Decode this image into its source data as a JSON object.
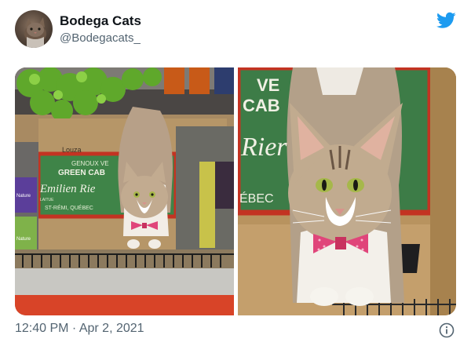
{
  "author": {
    "display_name": "Bodega Cats",
    "handle": "@Bodegacats_",
    "avatar_icon": "cat-avatar"
  },
  "brand": {
    "icon": "twitter-bird-icon",
    "color": "#1d9bf0"
  },
  "media": [
    {
      "icon": "cat-bow-tie-photo",
      "box_text": {
        "brand": "Louza",
        "line1": "GENOUX VE",
        "line2": "GREEN CAB",
        "line3": "Emilien Rie",
        "line4": "ST-RÉMI, QUÉBEC",
        "small": "LAITUE"
      },
      "packets": [
        "Nature",
        "Nature"
      ]
    },
    {
      "icon": "cat-closeup-photo",
      "box_text": {
        "line1": "VE",
        "line2": "CAB",
        "line3": "Rier",
        "line4": "ÉBEC"
      }
    }
  ],
  "footer": {
    "timestamp": "12:40 PM · Apr 2, 2021",
    "info_icon": "info-icon"
  }
}
